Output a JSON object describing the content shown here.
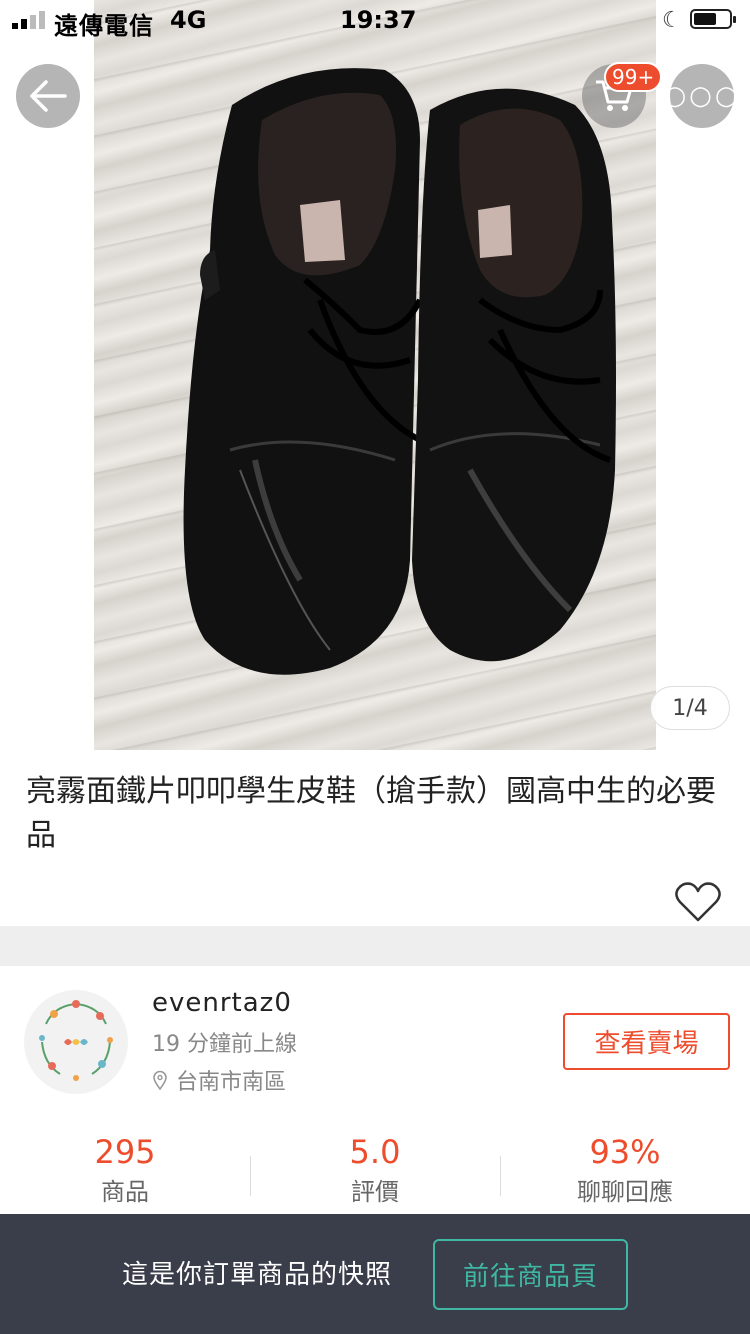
{
  "status_bar": {
    "carrier": "遠傳電信",
    "network": "4G",
    "time": "19:37",
    "icons": [
      "signal-icon",
      "moon-icon",
      "battery-icon"
    ]
  },
  "header": {
    "back_icon": "arrow-left-icon",
    "cart_icon": "cart-icon",
    "cart_badge": "99+",
    "more_icon": "ellipsis-icon"
  },
  "gallery": {
    "pager": "1/4"
  },
  "product": {
    "title": "亮霧面鐵片叩叩學生皮鞋（搶手款）國高中生的必要品",
    "like_icon": "heart-icon"
  },
  "seller": {
    "name": "evenrtaz0",
    "last_online": "19 分鐘前上線",
    "location": "台南市南區",
    "view_shop_label": "查看賣場"
  },
  "stats": [
    {
      "value": "295",
      "label": "商品"
    },
    {
      "value": "5.0",
      "label": "評價"
    },
    {
      "value": "93%",
      "label": "聊聊回應"
    }
  ],
  "bottom_bar": {
    "snapshot_text": "這是你訂單商品的快照",
    "goto_label": "前往商品頁"
  },
  "colors": {
    "accent": "#ee4d2d",
    "teal": "#3fb7a3",
    "bottom_bar_bg": "#3a3d4a"
  }
}
